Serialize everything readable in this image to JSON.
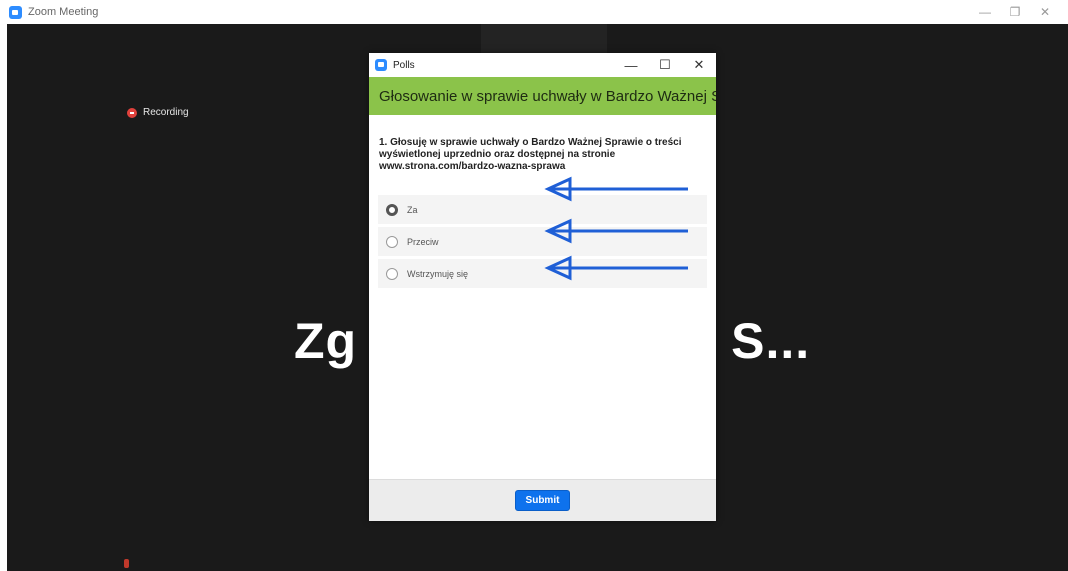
{
  "window": {
    "title": "Zoom Meeting",
    "controls": {
      "minimize": "—",
      "restore": "❐",
      "close": "✕"
    }
  },
  "meeting": {
    "recording_label": "Recording",
    "shared_title_left": "Zg",
    "shared_title_right": "S..."
  },
  "polls": {
    "title": "Polls",
    "controls": {
      "minimize": "—",
      "maximize": "☐",
      "close": "✕"
    },
    "header": "Głosowanie w sprawie uchwały w Bardzo Ważnej Sp...",
    "header_color": "#8bc34a",
    "question": "1. Głosuję w sprawie uchwały o Bardzo Ważnej Sprawie o treści wyświetlonej uprzednio oraz dostępnej na stronie www.strona.com/bardzo-wazna-sprawa",
    "options": [
      {
        "label": "Za",
        "selected": true
      },
      {
        "label": "Przeciw",
        "selected": false
      },
      {
        "label": "Wstrzymuję się",
        "selected": false
      }
    ],
    "submit_label": "Submit",
    "submit_color": "#0e72ed"
  },
  "annotations": {
    "arrow_color": "#1f5fd6"
  }
}
